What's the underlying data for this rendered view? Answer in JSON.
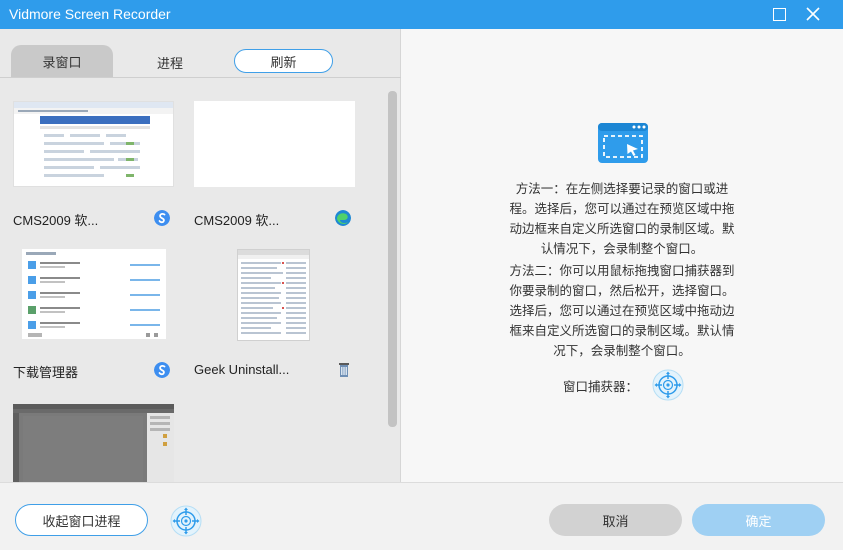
{
  "window": {
    "title": "Vidmore Screen Recorder"
  },
  "tabs": {
    "record_window": "录窗口",
    "process": "进程",
    "refresh": "刷新"
  },
  "thumbnails": [
    {
      "label": "CMS2009 软...",
      "icon": "sogou-browser-icon"
    },
    {
      "label": "CMS2009 软...",
      "icon": "edge-icon"
    },
    {
      "label": "下载管理器",
      "icon": "sogou-browser-icon"
    },
    {
      "label": "Geek Uninstall...",
      "icon": "recycle-bin-icon"
    },
    {
      "label": "",
      "icon": ""
    }
  ],
  "instructions": {
    "method1": [
      "方法一：在左侧选择要记录的窗口或进",
      "程。选择后，您可以通过在预览区域中拖",
      "动边框来自定义所选窗口的录制区域。默",
      "认情况下，会录制整个窗口。"
    ],
    "method2": [
      "方法二：你可以用鼠标拖拽窗口捕获器到",
      "你要录制的窗口，然后松开，选择窗口。",
      "选择后，您可以通过在预览区域中拖动边",
      "框来自定义所选窗口的录制区域。默认情",
      "况下，会录制整个窗口。"
    ],
    "capturer_label": "窗口捕获器："
  },
  "footer": {
    "collapse_label": "收起窗口进程",
    "cancel_label": "取消",
    "ok_label": "确定"
  },
  "colors": {
    "accent": "#2f9ceb",
    "ok_disabled": "#9fd0f3"
  }
}
